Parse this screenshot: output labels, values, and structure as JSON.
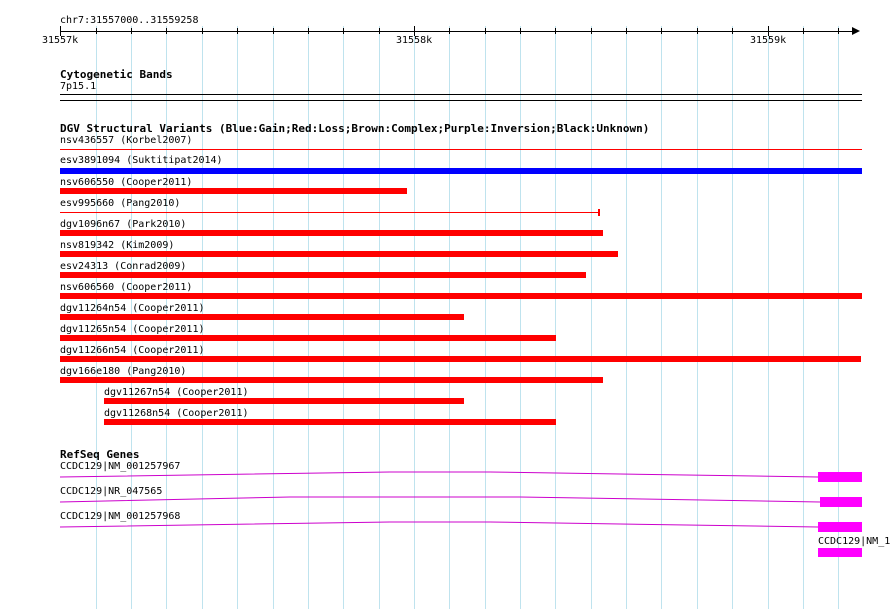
{
  "ruler": {
    "range_label": "chr7:31557000..31559258",
    "start_label": "31557k",
    "mid_label": "31558k",
    "end_label": "31559k"
  },
  "cytoband": {
    "title": "Cytogenetic Bands",
    "band": "7p15.1"
  },
  "dgv": {
    "title": "DGV Structural Variants (Blue:Gain;Red:Loss;Brown:Complex;Purple:Inversion;Black:Unknown)",
    "legend_colors": {
      "gain": "#0000ff",
      "loss": "#ff0000"
    },
    "variants": [
      {
        "label": "nsv436557 (Korbel2007)",
        "type": "loss"
      },
      {
        "label": "esv3891094 (Suktitipat2014)",
        "type": "gain"
      },
      {
        "label": "nsv606550 (Cooper2011)",
        "type": "loss"
      },
      {
        "label": "esv995660 (Pang2010)",
        "type": "loss"
      },
      {
        "label": "dgv1096n67 (Park2010)",
        "type": "loss"
      },
      {
        "label": "nsv819342 (Kim2009)",
        "type": "loss"
      },
      {
        "label": "esv24313 (Conrad2009)",
        "type": "loss"
      },
      {
        "label": "nsv606560 (Cooper2011)",
        "type": "loss"
      },
      {
        "label": "dgv11264n54 (Cooper2011)",
        "type": "loss"
      },
      {
        "label": "dgv11265n54 (Cooper2011)",
        "type": "loss"
      },
      {
        "label": "dgv11266n54 (Cooper2011)",
        "type": "loss"
      },
      {
        "label": "dgv166e180 (Pang2010)",
        "type": "loss"
      },
      {
        "label": "dgv11267n54 (Cooper2011)",
        "type": "loss"
      },
      {
        "label": "dgv11268n54 (Cooper2011)",
        "type": "loss"
      }
    ]
  },
  "refseq": {
    "title": "RefSeq Genes",
    "color": "#ff00ff",
    "genes": [
      {
        "label": "CCDC129|NM_001257967"
      },
      {
        "label": "CCDC129|NR_047565"
      },
      {
        "label": "CCDC129|NM_001257968"
      },
      {
        "label": "CCDC129|NM_1"
      }
    ]
  }
}
